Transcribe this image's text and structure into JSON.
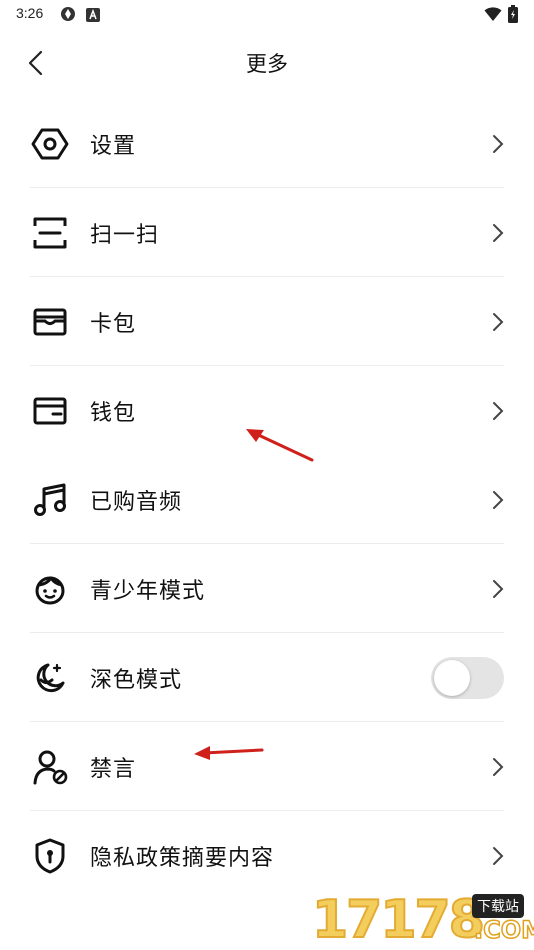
{
  "status_bar": {
    "time": "3:26",
    "left_icons": [
      "sync-icon",
      "a-badge-icon"
    ],
    "right_icons": [
      "wifi-icon",
      "battery-icon"
    ]
  },
  "header": {
    "title": "更多",
    "back_icon": "chevron-left-icon"
  },
  "menu": {
    "items": [
      {
        "label": "设置",
        "icon": "settings-hexagon-icon",
        "control": "chevron"
      },
      {
        "label": "扫一扫",
        "icon": "scan-icon",
        "control": "chevron"
      },
      {
        "label": "卡包",
        "icon": "card-wallet-icon",
        "control": "chevron"
      },
      {
        "label": "钱包",
        "icon": "wallet-icon",
        "control": "chevron"
      },
      {
        "label": "已购音频",
        "icon": "music-note-icon",
        "control": "chevron"
      },
      {
        "label": "青少年模式",
        "icon": "smiley-face-icon",
        "control": "chevron"
      },
      {
        "label": "深色模式",
        "icon": "moon-icon",
        "control": "toggle",
        "toggle_on": false
      },
      {
        "label": "禁言",
        "icon": "user-muted-icon",
        "control": "chevron"
      },
      {
        "label": "隐私政策摘要内容",
        "icon": "shield-keyhole-icon",
        "control": "chevron"
      }
    ]
  },
  "watermark": {
    "number": "17178",
    "tag": "下载站",
    "domain": ".COM"
  },
  "colors": {
    "annotation_arrow": "#d0201c",
    "toggle_off": "#e4e4e4",
    "divider": "#ececec"
  }
}
